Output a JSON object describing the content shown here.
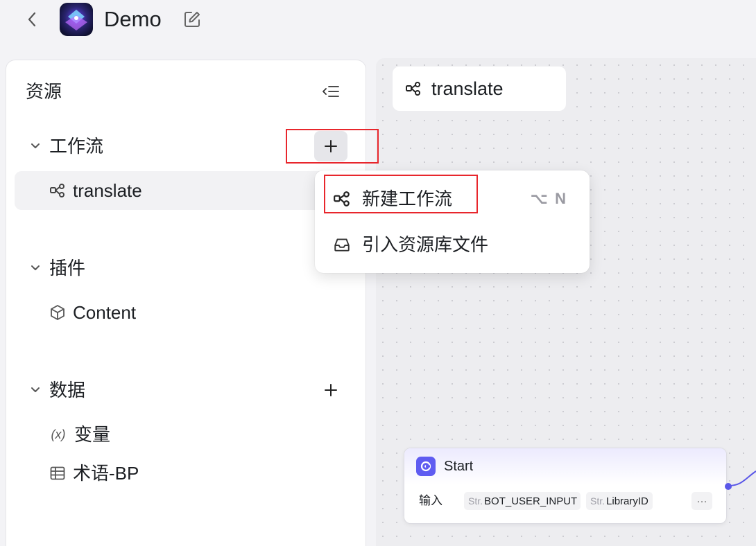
{
  "header": {
    "app_title": "Demo"
  },
  "sidebar": {
    "title": "资源",
    "sections": {
      "workflow": {
        "label": "工作流",
        "items": [
          {
            "label": "translate"
          }
        ]
      },
      "plugin": {
        "label": "插件",
        "items": [
          {
            "label": "Content"
          }
        ]
      },
      "data": {
        "label": "数据",
        "items": [
          {
            "label": "变量",
            "icon_text": "(x)"
          },
          {
            "label": "术语-BP"
          }
        ]
      }
    }
  },
  "menu": {
    "items": [
      {
        "label": "新建工作流",
        "shortcut": "⌥ N"
      },
      {
        "label": "引入资源库文件"
      }
    ]
  },
  "canvas": {
    "tab_label": "translate",
    "start_node": {
      "title": "Start",
      "input_label": "输入",
      "params": [
        {
          "type": "Str.",
          "name": "BOT_USER_INPUT"
        },
        {
          "type": "Str.",
          "name": "LibraryID"
        }
      ],
      "more": "···"
    }
  },
  "colors": {
    "accent": "#5f5cf1",
    "highlight_box": "#e8262c"
  }
}
